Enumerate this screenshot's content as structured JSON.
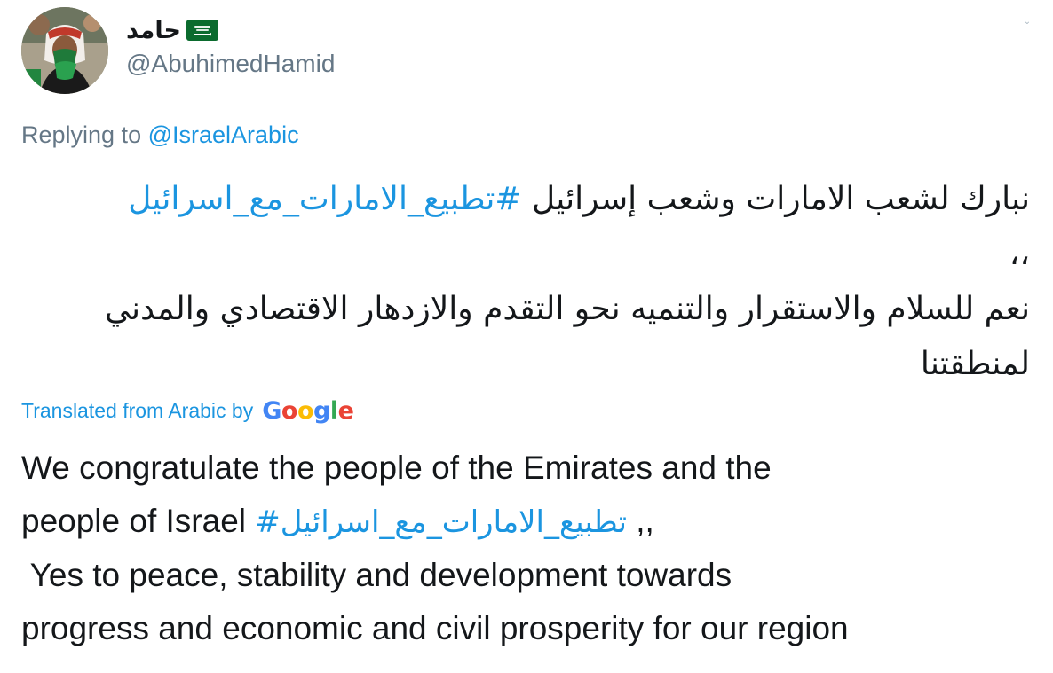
{
  "tweet": {
    "display_name": "حامد",
    "handle": "@AbuhimedHamid",
    "avatar_icon": "profile-photo",
    "flag_icon": "saudi-arabia-flag",
    "menu_icon": "chevron-down-icon",
    "replying_prefix": "Replying to",
    "replying_to": "@IsraelArabic",
    "arabic_line1_text": "نبارك لشعب الامارات وشعب إسرائيل ",
    "hashtag": "#تطبيع_الامارات_مع_اسرائيل",
    "arabic_line2": "،،",
    "arabic_line3": "نعم للسلام والاستقرار والتنميه نحو التقدم والازدهار الاقتصادي والمدني لمنطقتنا",
    "translated_label": "Translated from Arabic by",
    "google_letters": [
      "G",
      "o",
      "o",
      "g",
      "l",
      "e"
    ],
    "translation_line1": "We congratulate the people of the Emirates and the",
    "translation_line2_prefix": "people of Israel ",
    "translation_line2_suffix": " ,,",
    "translation_line3": " Yes to peace, stability and development towards",
    "translation_line4": "progress and economic and civil prosperity for our region",
    "colors": {
      "link": "#1b95e0",
      "muted": "#657786",
      "text": "#14171a"
    }
  }
}
